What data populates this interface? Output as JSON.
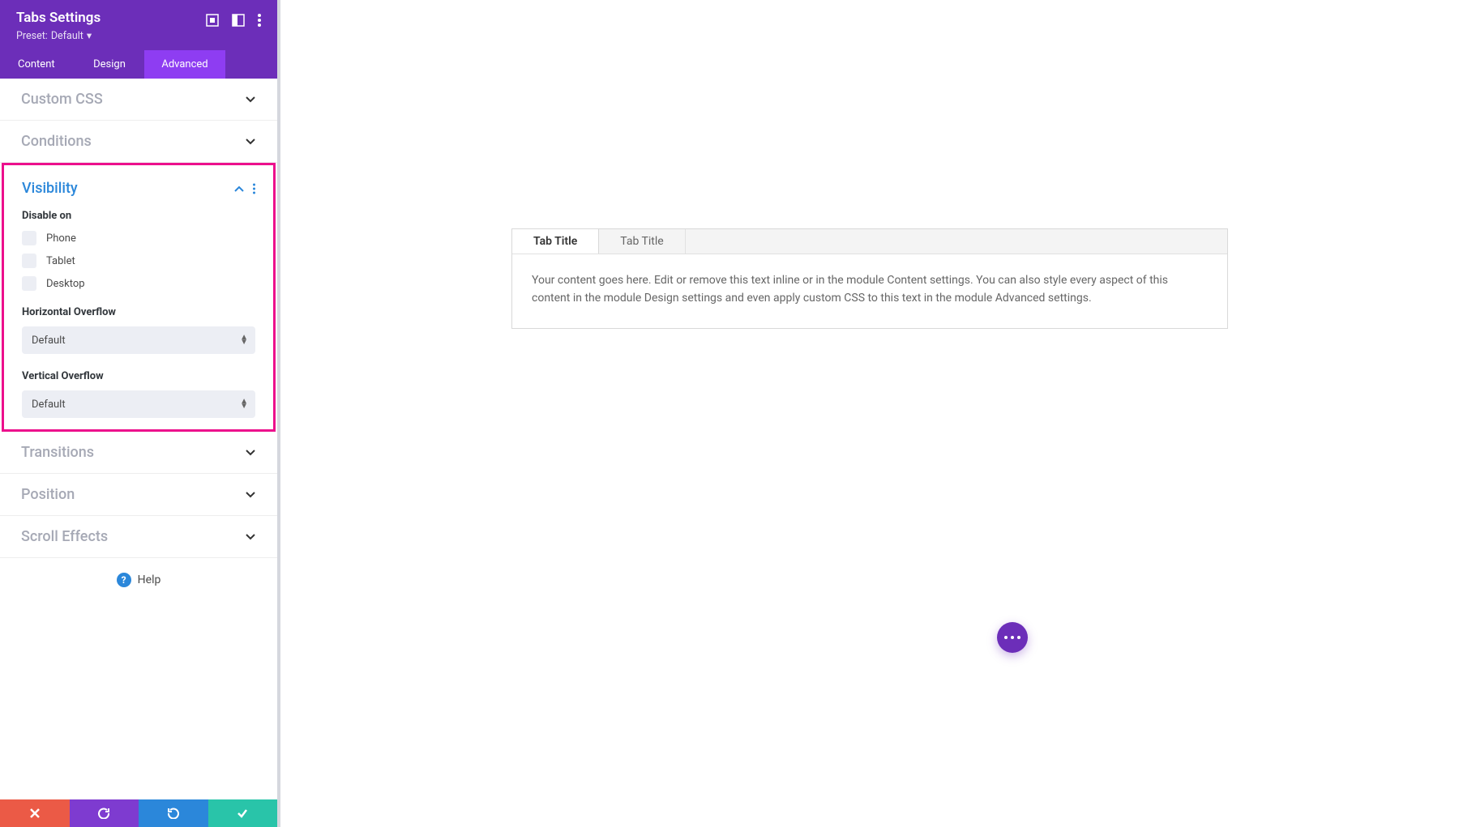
{
  "header": {
    "title": "Tabs Settings",
    "preset_prefix": "Preset:",
    "preset_value": "Default"
  },
  "tabs": {
    "content": "Content",
    "design": "Design",
    "advanced": "Advanced"
  },
  "sections": {
    "custom_css": "Custom CSS",
    "conditions": "Conditions",
    "visibility": "Visibility",
    "transitions": "Transitions",
    "position": "Position",
    "scroll_effects": "Scroll Effects"
  },
  "visibility": {
    "disable_on": "Disable on",
    "options": [
      "Phone",
      "Tablet",
      "Desktop"
    ],
    "horizontal_overflow_label": "Horizontal Overflow",
    "horizontal_overflow_value": "Default",
    "vertical_overflow_label": "Vertical Overflow",
    "vertical_overflow_value": "Default"
  },
  "help": "Help",
  "preview": {
    "tab1": "Tab Title",
    "tab2": "Tab Title",
    "content": "Your content goes here. Edit or remove this text inline or in the module Content settings. You can also style every aspect of this content in the module Design settings and even apply custom CSS to this text in the module Advanced settings."
  }
}
